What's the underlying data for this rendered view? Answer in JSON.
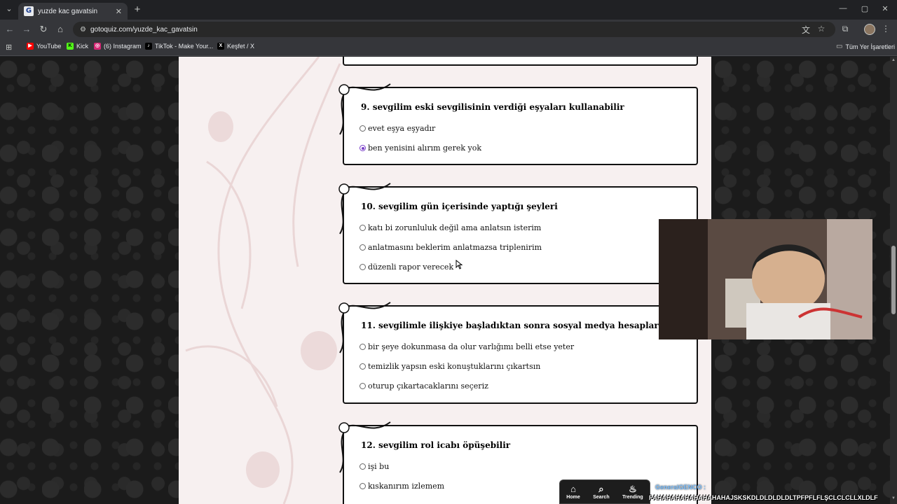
{
  "browser": {
    "tab_title": "yuzde kac gavatsin",
    "favicon_letter": "G",
    "url": "gotoquiz.com/yuzde_kac_gavatsin",
    "window_controls": [
      "—",
      "▢",
      "✕"
    ],
    "bookmarks": [
      {
        "label": "YouTube",
        "icon_color": "#ff0000",
        "icon": "youtube-icon"
      },
      {
        "label": "Kick",
        "icon_color": "#53fc18",
        "icon": "kick-icon"
      },
      {
        "label": "(6) Instagram",
        "icon_color": "#d62976",
        "icon": "instagram-icon"
      },
      {
        "label": "TikTok - Make Your...",
        "icon_color": "#000000",
        "icon": "tiktok-icon"
      },
      {
        "label": "Keşfet / X",
        "icon_color": "#000000",
        "icon": "x-icon"
      }
    ],
    "all_bookmarks_label": "Tüm Yer İşaretleri"
  },
  "quiz": {
    "accent_color": "#7a3fc9",
    "questions": [
      {
        "title": "9. sevgilim eski sevgilisinin verdiği eşyaları kullanabilir",
        "options": [
          {
            "label": "evet eşya eşyadır",
            "checked": false
          },
          {
            "label": "ben yenisini alırım gerek yok",
            "checked": true
          }
        ]
      },
      {
        "title": "10. sevgilim gün içerisinde yaptığı şeyleri",
        "options": [
          {
            "label": "katı bi zorunluluk değil ama anlatsın isterim",
            "checked": false
          },
          {
            "label": "anlatmasını beklerim anlatmazsa triplenirim",
            "checked": false
          },
          {
            "label": "düzenli rapor verecek",
            "checked": false
          }
        ]
      },
      {
        "title": "11. sevgilimle ilişkiye başladıktan sonra sosyal medya hesaplarında",
        "options": [
          {
            "label": "bir şeye dokunmasa da olur varlığımı belli etse yeter",
            "checked": false
          },
          {
            "label": "temizlik yapsın eski konuştuklarını çıkartsın",
            "checked": false
          },
          {
            "label": "oturup çıkartacaklarını seçeriz",
            "checked": false
          }
        ]
      },
      {
        "title": "12. sevgilim rol icabı öpüşebilir",
        "options": [
          {
            "label": "işi bu",
            "checked": false
          },
          {
            "label": "kıskanırım izlemem",
            "checked": false
          }
        ]
      }
    ]
  },
  "stream_overlay": {
    "nav": [
      {
        "label": "Home",
        "icon": "home-icon"
      },
      {
        "label": "Search",
        "icon": "search-icon"
      },
      {
        "label": "Trending",
        "icon": "flame-icon"
      }
    ],
    "chat_user": "GeneralGENCO :",
    "chat_message": "PAHAHAHAHAHAHAHAHAJSKSKDLDLDLDLDLTPFPFLFLŞCLCLCLLXLDLF"
  }
}
